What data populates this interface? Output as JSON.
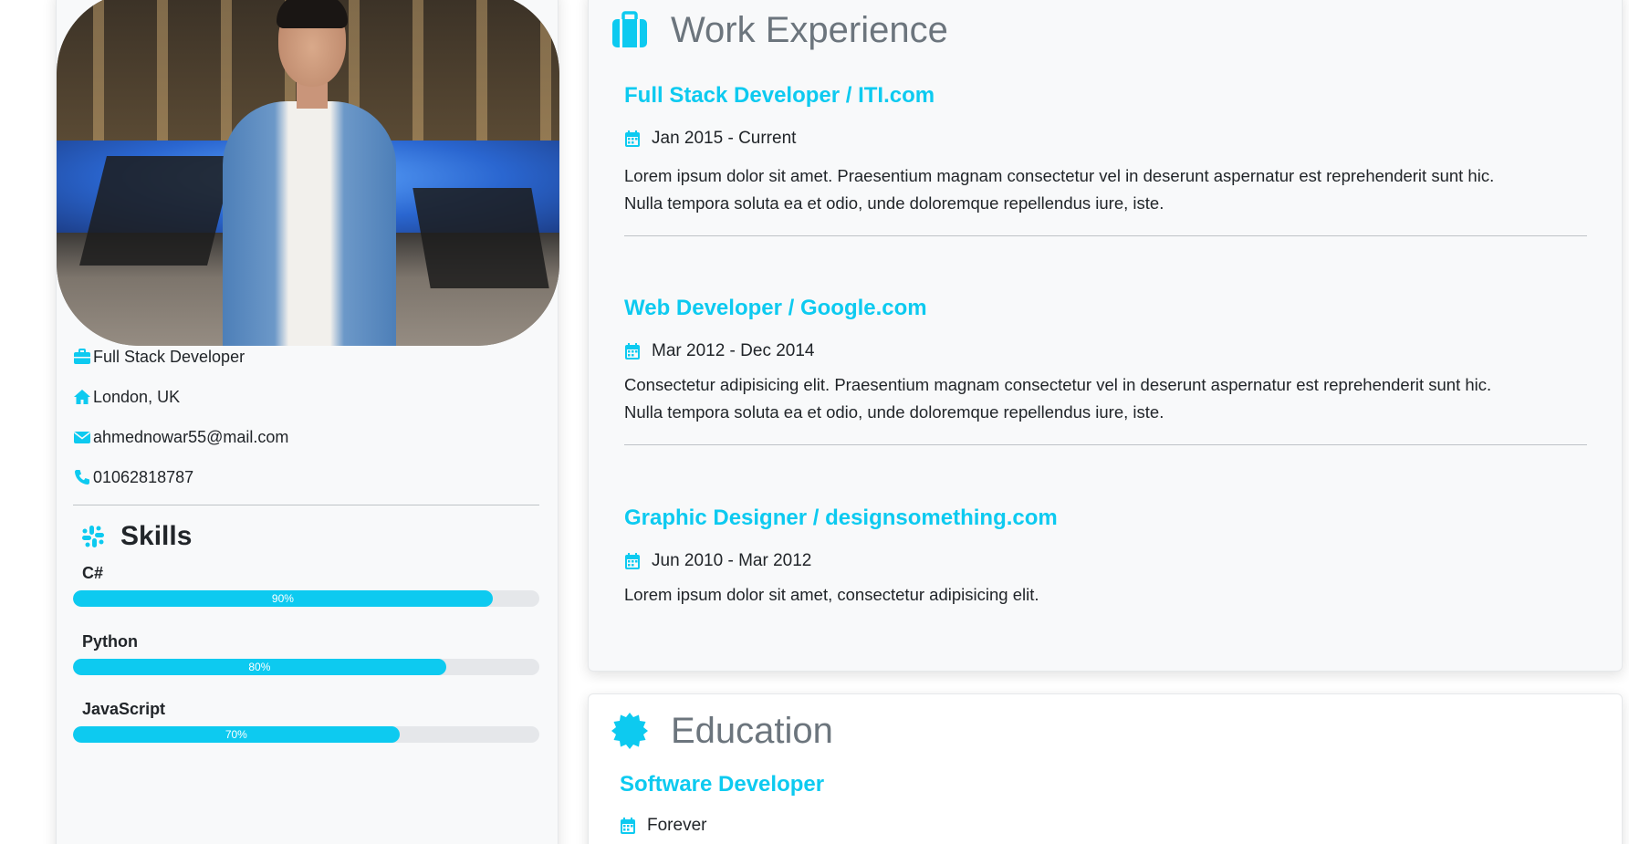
{
  "profile": {
    "title": "Full Stack Developer",
    "location": "London, UK",
    "email": "ahmednowar55@mail.com",
    "phone": "01062818787"
  },
  "skills": {
    "heading": "Skills",
    "items": [
      {
        "name": "C#",
        "percent_label": "90%",
        "value": 0.9
      },
      {
        "name": "Python",
        "percent_label": "80%",
        "value": 0.8
      },
      {
        "name": "JavaScript",
        "percent_label": "70%",
        "value": 0.7
      }
    ]
  },
  "work": {
    "heading": "Work Experience",
    "jobs": [
      {
        "title": "Full Stack Developer / ITI.com",
        "date": "Jan 2015 - Current",
        "desc_line1": "Lorem ipsum dolor sit amet. Praesentium magnam consectetur vel in deserunt aspernatur est reprehenderit sunt hic.",
        "desc_line2": "Nulla tempora soluta ea et odio, unde doloremque repellendus iure, iste."
      },
      {
        "title": "Web Developer / Google.com",
        "date": "Mar 2012 - Dec 2014",
        "desc_line1": "Consectetur adipisicing elit. Praesentium magnam consectetur vel in deserunt aspernatur est reprehenderit sunt hic.",
        "desc_line2": "Nulla tempora soluta ea et odio, unde doloremque repellendus iure, iste."
      },
      {
        "title": "Graphic Designer / designsomething.com",
        "date": "Jun 2010 - Mar 2012",
        "desc_line1": "Lorem ipsum dolor sit amet, consectetur adipisicing elit."
      }
    ]
  },
  "education": {
    "heading": "Education",
    "items": [
      {
        "title": "Software Developer",
        "date": "Forever"
      }
    ]
  },
  "colors": {
    "accent": "#0dcaf0",
    "heading_gray": "#6c757d",
    "card_bg": "#f8f9fa"
  },
  "icons": {
    "title": "briefcase-icon",
    "location": "home-icon",
    "email": "envelope-icon",
    "phone": "phone-icon",
    "skills": "slack-icon",
    "work": "suitcase-icon",
    "education": "certificate-icon",
    "date": "calendar-icon"
  }
}
